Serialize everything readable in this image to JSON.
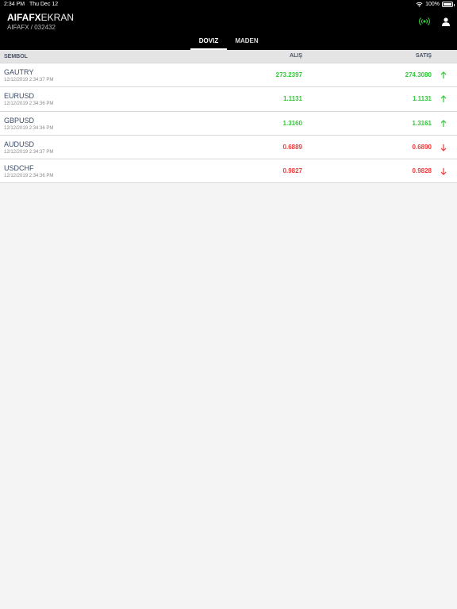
{
  "status_bar": {
    "time": "2:34 PM",
    "date": "Thu Dec 12",
    "battery": "100%",
    "icons": [
      "wifi-icon",
      "battery-icon"
    ]
  },
  "app": {
    "brand_bold": "AIFAFX",
    "brand_light": "EKRAN",
    "account": "AIFAFX / 032432",
    "icons": [
      "signal-broadcast-icon",
      "user-icon"
    ]
  },
  "tabs": [
    {
      "label": "DOVIZ",
      "active": true
    },
    {
      "label": "MADEN",
      "active": false
    }
  ],
  "columns": {
    "symbol": "SEMBOL",
    "bid": "ALIŞ",
    "ask": "SATIŞ"
  },
  "colors": {
    "up": "#32c83a",
    "down": "#ef3b3b",
    "signal": "#32c83a"
  },
  "rows": [
    {
      "symbol": "GAUTRY",
      "timestamp": "12/12/2019 2:34:37 PM",
      "bid": "273.2397",
      "ask": "274.3080",
      "direction": "up"
    },
    {
      "symbol": "EURUSD",
      "timestamp": "12/12/2019 2:34:36 PM",
      "bid": "1.1131",
      "ask": "1.1131",
      "direction": "up"
    },
    {
      "symbol": "GBPUSD",
      "timestamp": "12/12/2019 2:34:36 PM",
      "bid": "1.3160",
      "ask": "1.3161",
      "direction": "up"
    },
    {
      "symbol": "AUDUSD",
      "timestamp": "12/12/2019 2:34:37 PM",
      "bid": "0.6889",
      "ask": "0.6890",
      "direction": "down"
    },
    {
      "symbol": "USDCHF",
      "timestamp": "12/12/2019 2:34:36 PM",
      "bid": "0.9827",
      "ask": "0.9828",
      "direction": "down"
    }
  ]
}
